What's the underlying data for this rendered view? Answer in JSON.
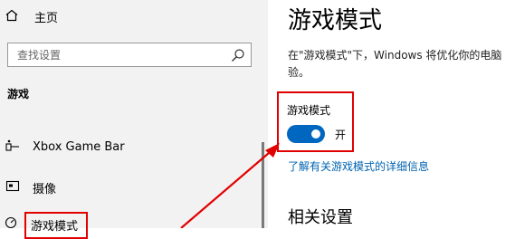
{
  "sidebar": {
    "home_label": "主页",
    "search_placeholder": "查找设置",
    "section_header": "游戏",
    "items": [
      {
        "label": "Xbox Game Bar",
        "icon": "xbox-game-bar-icon"
      },
      {
        "label": "摄像",
        "icon": "capture-icon"
      },
      {
        "label": "游戏模式",
        "icon": "game-mode-icon"
      }
    ]
  },
  "main": {
    "title": "游戏模式",
    "description_line1": "在\"游戏模式\"下，Windows 将优化你的电脑",
    "description_line2": "验。",
    "toggle_label": "游戏模式",
    "toggle_state": "开",
    "link_text": "了解有关游戏模式的详细信息",
    "related_header": "相关设置"
  },
  "colors": {
    "accent": "#0067c0",
    "highlight": "#e10000",
    "link": "#0063b1",
    "sidebar_bg": "#f2f2f2"
  }
}
